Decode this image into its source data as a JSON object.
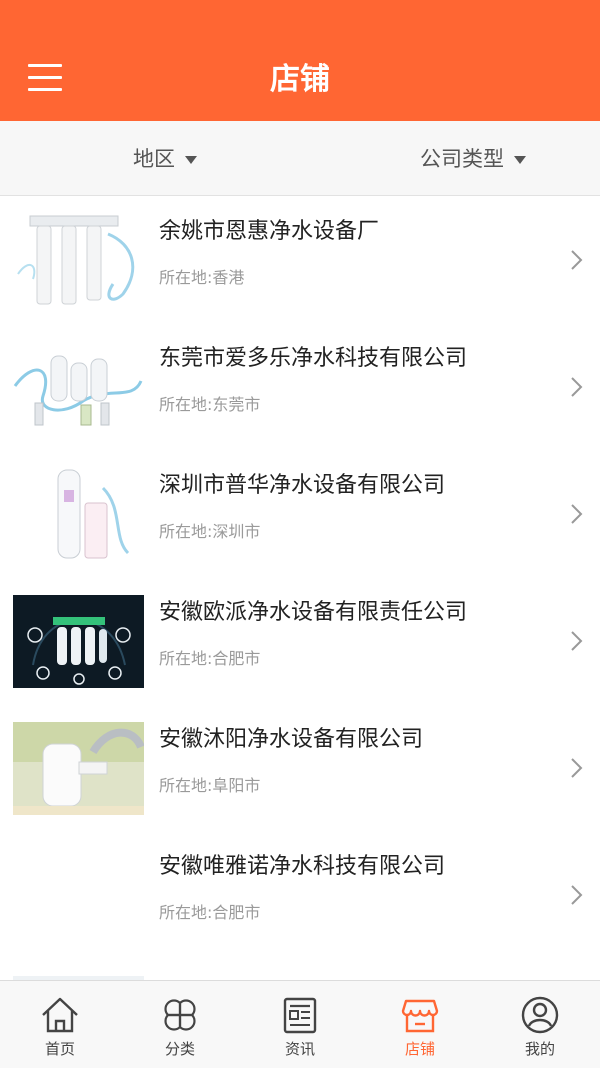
{
  "header": {
    "title": "店铺",
    "menu_icon": "hamburger-menu-icon"
  },
  "filters": {
    "region": {
      "label": "地区",
      "icon": "triangle-down-icon"
    },
    "company_type": {
      "label": "公司类型",
      "icon": "triangle-down-icon"
    }
  },
  "shops": [
    {
      "name": "余姚市恩惠净水设备厂",
      "location": "所在地:香港",
      "thumb": "water-filter-pipes-image"
    },
    {
      "name": "东莞市爱多乐净水科技有限公司",
      "location": "所在地:东莞市",
      "thumb": "water-purifier-set-image"
    },
    {
      "name": "深圳市普华净水设备有限公司",
      "location": "所在地:深圳市",
      "thumb": "softener-tank-image"
    },
    {
      "name": "安徽欧派净水设备有限责任公司",
      "location": "所在地:合肥市",
      "thumb": "ro-system-dark-image"
    },
    {
      "name": "安徽沐阳净水设备有限公司",
      "location": "所在地:阜阳市",
      "thumb": "faucet-filter-image"
    },
    {
      "name": "安徽唯雅诺净水科技有限公司",
      "location": "所在地:合肥市",
      "thumb": "blank-image"
    }
  ],
  "tabs": [
    {
      "label": "首页",
      "icon": "home-icon",
      "active": false
    },
    {
      "label": "分类",
      "icon": "category-petals-icon",
      "active": false
    },
    {
      "label": "资讯",
      "icon": "news-icon",
      "active": false
    },
    {
      "label": "店铺",
      "icon": "shop-icon",
      "active": true
    },
    {
      "label": "我的",
      "icon": "user-profile-icon",
      "active": false
    }
  ],
  "colors": {
    "accent": "#ff6633",
    "tab_inactive": "#444444",
    "subtext": "#9a9a9a"
  }
}
